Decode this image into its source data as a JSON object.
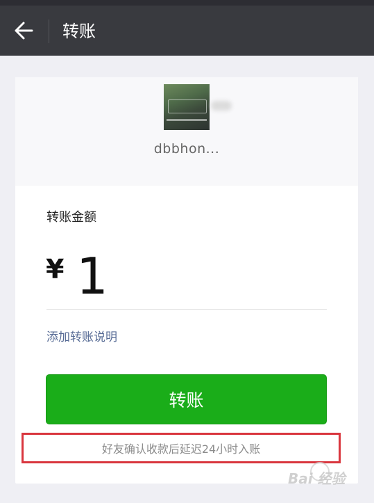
{
  "header": {
    "title": "转账",
    "back_icon": "arrow-left-icon"
  },
  "recipient": {
    "name": "dbbhon..."
  },
  "form": {
    "amount_label": "转账金额",
    "currency_symbol": "¥",
    "amount": "1",
    "add_note_link": "添加转账说明"
  },
  "actions": {
    "transfer_button": "转账"
  },
  "notice": {
    "text": "好友确认收款后延迟24小时入账"
  },
  "watermark": {
    "text": "Bai 经验"
  },
  "colors": {
    "navbar": "#393a3f",
    "primary_button": "#1aad19",
    "link": "#576b95",
    "highlight_border": "#d9363e",
    "page_background": "#efeff4"
  }
}
